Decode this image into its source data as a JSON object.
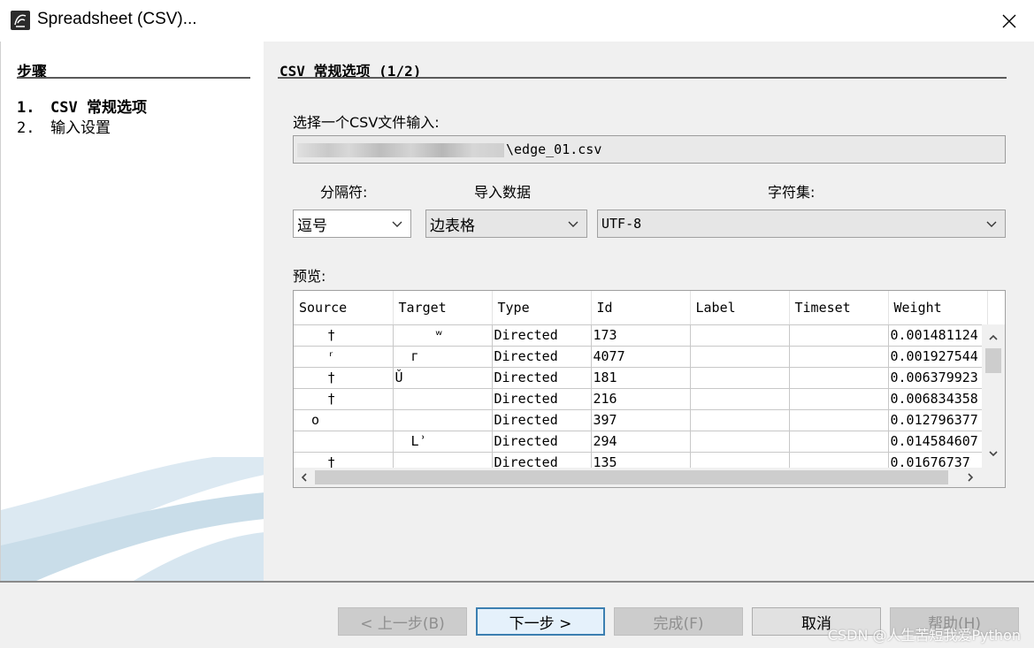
{
  "window": {
    "title": "Spreadsheet (CSV)..."
  },
  "sidebar": {
    "title": "步骤",
    "steps": [
      {
        "num": "1.",
        "label": "CSV 常规选项"
      },
      {
        "num": "2.",
        "label": "输入设置"
      }
    ]
  },
  "main": {
    "section_title": "CSV 常规选项 (1/2)",
    "file_label": "选择一个CSV文件输入:",
    "file_value": "\\edge_01.csv",
    "separator_label": "分隔符:",
    "import_label": "导入数据",
    "charset_label": "字符集:",
    "separator_value": "逗号",
    "import_value": "边表格",
    "charset_value": "UTF-8",
    "preview_label": "预览:",
    "preview": {
      "columns": [
        "Source",
        "Target",
        "Type",
        "Id",
        "Label",
        "Timeset",
        "Weight"
      ],
      "rows": [
        [
          "    †",
          "     ʷ",
          "Directed",
          "173",
          "",
          "",
          "0.001481124"
        ],
        [
          "    ʳ",
          "  г",
          "Directed",
          "4077",
          "",
          "",
          "0.001927544"
        ],
        [
          "    †",
          "Ǔ",
          "Directed",
          "181",
          "",
          "",
          "0.006379923"
        ],
        [
          "    †",
          "",
          "Directed",
          "216",
          "",
          "",
          "0.006834358"
        ],
        [
          "  ο",
          "",
          "Directed",
          "397",
          "",
          "",
          "0.012796377"
        ],
        [
          "",
          "  Lʾ",
          "Directed",
          "294",
          "",
          "",
          "0.014584607"
        ],
        [
          "    †",
          "",
          "Directed",
          "135",
          "",
          "",
          "0.01676737"
        ]
      ]
    }
  },
  "footer": {
    "back": "< 上一步(B)",
    "next": "下一步 >",
    "finish": "完成(F)",
    "cancel": "取消",
    "help": "帮助(H)",
    "watermark": "CSDN @人生苦短我爱Python"
  }
}
